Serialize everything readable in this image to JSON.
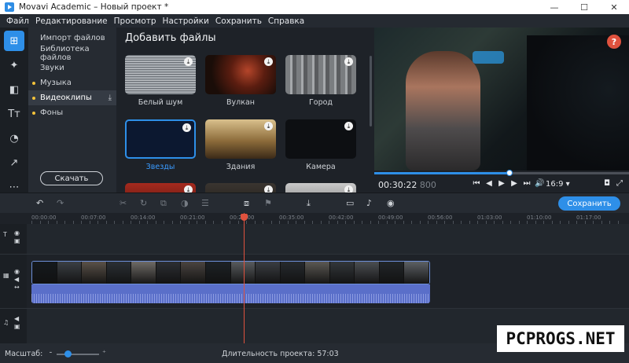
{
  "window": {
    "title": "Movavi Academic – Новый проект *",
    "minimize": "—",
    "maximize": "☐",
    "close": "✕"
  },
  "menu": [
    {
      "label": "Файл"
    },
    {
      "label": "Редактирование"
    },
    {
      "label": "Просмотр"
    },
    {
      "label": "Настройки"
    },
    {
      "label": "Сохранить"
    },
    {
      "label": "Справка"
    }
  ],
  "tools": [
    {
      "icon": "import-icon",
      "glyph": "⊞",
      "active": true
    },
    {
      "icon": "magic-wand-icon",
      "glyph": "✦"
    },
    {
      "icon": "transitions-icon",
      "glyph": "◧"
    },
    {
      "icon": "titles-icon",
      "glyph": "Tт"
    },
    {
      "icon": "stickers-icon",
      "glyph": "◔"
    },
    {
      "icon": "zoom-icon",
      "glyph": "↗"
    },
    {
      "icon": "more-tools-icon",
      "glyph": "⋯"
    }
  ],
  "categories": {
    "items": [
      {
        "label": "Импорт файлов"
      },
      {
        "label": "Библиотека файлов"
      },
      {
        "label": "Звуки"
      },
      {
        "label": "Музыка",
        "dot": true
      },
      {
        "label": "Видеоклипы",
        "dot": true,
        "active": true,
        "download": "⤓"
      },
      {
        "label": "Фоны",
        "dot": true
      }
    ],
    "download_button": "Скачать"
  },
  "gallery": {
    "title": "Добавить файлы",
    "download_glyph": "⤓",
    "items": [
      {
        "label": "Белый шум",
        "style": "t-noise"
      },
      {
        "label": "Вулкан",
        "style": "t-volcano"
      },
      {
        "label": "Город",
        "style": "t-city"
      },
      {
        "label": "Звезды",
        "style": "t-stars",
        "selected": true
      },
      {
        "label": "Здания",
        "style": "t-buildings"
      },
      {
        "label": "Камера",
        "style": "t-camera"
      },
      {
        "label": "",
        "style": "t-red"
      },
      {
        "label": "",
        "style": "t-dark1"
      },
      {
        "label": "",
        "style": "t-clock"
      }
    ]
  },
  "preview": {
    "help": "?",
    "progress": 0.53,
    "timecode": "00:30:22",
    "timecode_ms": "800",
    "aspect": "16:9 ▾",
    "controls": [
      "⏮",
      "◀",
      "▶",
      "▶",
      "⏭",
      "🔊"
    ]
  },
  "timeline_toolbar": {
    "save_label": "Сохранить"
  },
  "ruler": [
    "00:00:00",
    "00:07:00",
    "00:14:00",
    "00:21:00",
    "00:28:00",
    "00:35:00",
    "00:42:00",
    "00:49:00",
    "00:56:00",
    "01:03:00",
    "01:10:00",
    "01:17:00"
  ],
  "status": {
    "scale_label": "Масштаб:",
    "zoom_level": 0.25,
    "duration": "Длительность проекта:  57:03"
  },
  "watermark": "PCPROGS.NET"
}
